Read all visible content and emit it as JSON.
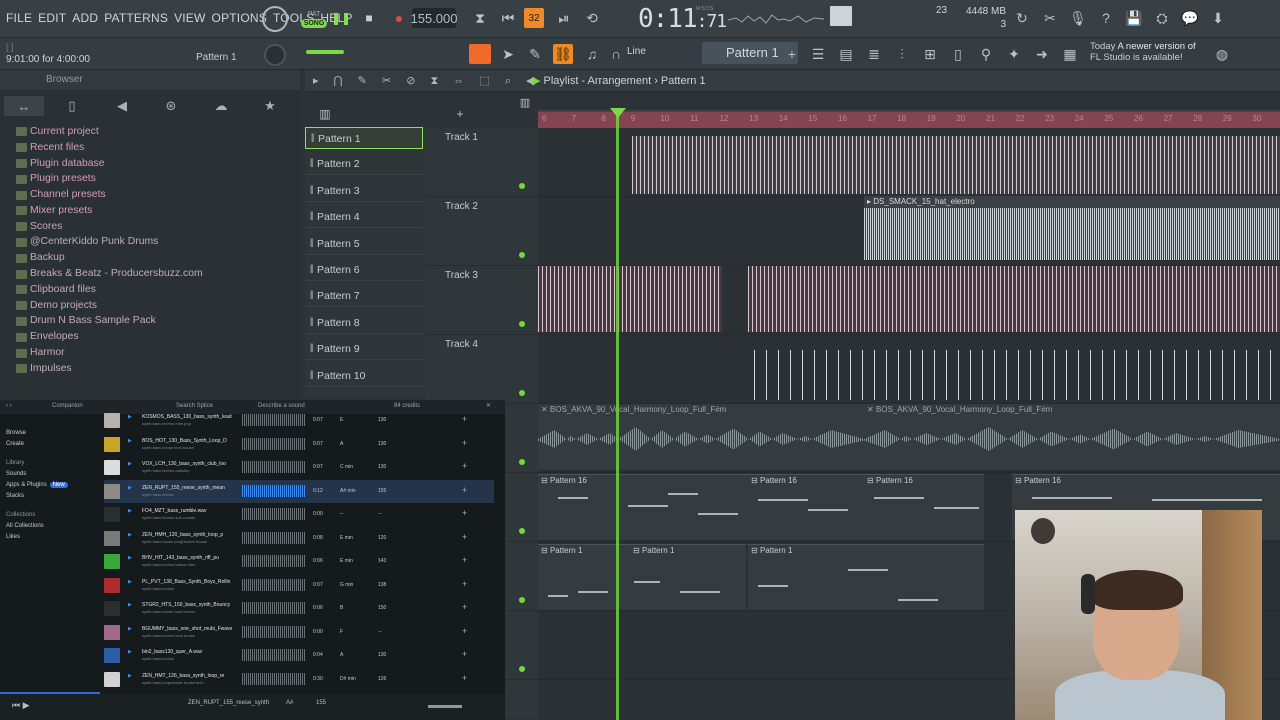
{
  "menu": [
    "FILE",
    "EDIT",
    "ADD",
    "PATTERNS",
    "VIEW",
    "OPTIONS",
    "TOOLS",
    "HELP"
  ],
  "transport": {
    "mode_pat": "PAT",
    "mode_song": "SONG",
    "tempo": "155.000",
    "time": "0:11",
    "time_ms": ":71",
    "mcs_label": "M:S:CS",
    "cpu_value": "23",
    "memory": "4448 MB",
    "polyphony": "3"
  },
  "hint": {
    "position": "9:01:00 for 4:00:00",
    "pattern": "Pattern 1"
  },
  "snap": {
    "mode": "Line",
    "pattern_name": "Pattern 1"
  },
  "news": {
    "date": "Today",
    "line1": "A newer version of",
    "line2": "FL Studio is available!"
  },
  "browser": {
    "title": "Browser",
    "items": [
      "Current project",
      "Recent files",
      "Plugin database",
      "Plugin presets",
      "Channel presets",
      "Mixer presets",
      "Scores",
      "@CenterKiddo Punk Drums",
      "Backup",
      "Breaks & Beatz - Producersbuzz.com",
      "Clipboard files",
      "Demo projects",
      "Drum N Bass Sample Pack",
      "Envelopes",
      "Harmor",
      "Impulses"
    ]
  },
  "patterns": [
    "Pattern 1",
    "Pattern 2",
    "Pattern 3",
    "Pattern 4",
    "Pattern 5",
    "Pattern 6",
    "Pattern 7",
    "Pattern 8",
    "Pattern 9",
    "Pattern 10"
  ],
  "playlist": {
    "caption": "Playlist - Arrangement",
    "caption_pattern": "Pattern 1",
    "ruler": [
      "6",
      "7",
      "8",
      "9",
      "10",
      "11",
      "12",
      "13",
      "14",
      "15",
      "16",
      "17",
      "18",
      "19",
      "20",
      "21",
      "22",
      "23",
      "24",
      "25",
      "26",
      "27",
      "28",
      "29",
      "30"
    ],
    "tracks": [
      "Track 1",
      "Track 2",
      "Track 3",
      "Track 4"
    ],
    "clip_hat": "DS_SMACK_15_hat_electro",
    "clip_vocal": "BOS_AKVA_90_Vocal_Harmony_Loop_Full_F#m",
    "clip_pattern16": "Pattern 16",
    "clip_pattern1": "Pattern 1"
  },
  "companion": {
    "title": "Companion",
    "search_placeholder": "Search Splice",
    "describe": "Describe a sound",
    "credits": "84 credits",
    "sidebar": [
      "Browse",
      "Create",
      "Library",
      "Sounds",
      "Apps & Plugins",
      "Stacks",
      "Collections",
      "All Collections",
      "Likes"
    ],
    "new_tag": "New",
    "rows": [
      {
        "name": "KOSMOS_BASS_130_bass_synth_lead",
        "tags": "synth  bass  techno  edm  pop",
        "dur": "0:07",
        "key": "E",
        "bpm": "130",
        "color": "#b8b2a8"
      },
      {
        "name": "BOS_HOT_130_Bass_Synth_Loop_D",
        "tags": "synth  bass  house  tech house",
        "dur": "0:07",
        "key": "A",
        "bpm": "130",
        "color": "#c9a62a"
      },
      {
        "name": "VOX_LCH_130_bass_synth_club_loo",
        "tags": "synth  bass  techno  dubstep",
        "dur": "0:07",
        "key": "C min",
        "bpm": "130",
        "color": "#dcdcdc"
      },
      {
        "name": "ZEN_RUPT_155_reese_synth_mean",
        "tags": "synth  bass  techno",
        "dur": "0:12",
        "key": "A# min",
        "bpm": "155",
        "color": "#8e8a86"
      },
      {
        "name": "FO4_MZT_bass_rumble.wav",
        "tags": "synth  bass  techno  sub  rumble",
        "dur": "0:00",
        "key": "--",
        "bpm": "--",
        "color": "#2a2e31"
      },
      {
        "name": "ZEN_HMH_120_bass_synth_loop_p",
        "tags": "synth  bass  house  progressive house",
        "dur": "0:08",
        "key": "E min",
        "bpm": "120",
        "color": "#7a7a7a"
      },
      {
        "name": "BHV_HIT_143_bass_synth_riff_pu",
        "tags": "synth  bass  techno  trance  edm",
        "dur": "0:06",
        "key": "E min",
        "bpm": "143",
        "color": "#3aa83a"
      },
      {
        "name": "PL_PVT_138_Bass_Synth_Boys_Rollin",
        "tags": "synth  bass  techno",
        "dur": "0:07",
        "key": "G min",
        "bpm": "138",
        "color": "#b02b2b"
      },
      {
        "name": "STGR2_HTS_150_bass_synth_Bouncy",
        "tags": "synth  bass  house  hard techno",
        "dur": "0:06",
        "key": "B",
        "bpm": "150",
        "color": "#2a2e31"
      },
      {
        "name": "BGUMMY_bass_one_shot_mubi_Fwave",
        "tags": "synth  bass  techno  tech house",
        "dur": "0:00",
        "key": "F",
        "bpm": "--",
        "color": "#a06a8a"
      },
      {
        "name": "bin2_bass130_quer_A.wav",
        "tags": "synth  bass  techno",
        "dur": "0:04",
        "key": "A",
        "bpm": "130",
        "color": "#2d5fa8"
      },
      {
        "name": "ZEN_HMT_126_bass_synth_loop_re",
        "tags": "synth  bass  progressive house  tech",
        "dur": "0:30",
        "key": "D# min",
        "bpm": "126",
        "color": "#d2d2d2"
      }
    ],
    "footer_name": "ZEN_RUPT_155_reese_synth",
    "footer_key": "A#",
    "footer_bpm": "155"
  }
}
